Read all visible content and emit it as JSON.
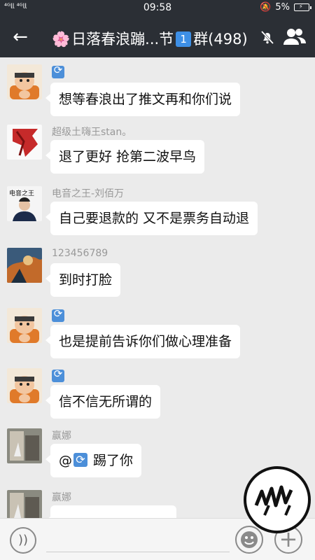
{
  "status_bar": {
    "signal_left": "⁴ᴳ𝗅𝗅 ⁴ᴳ𝗅𝗅",
    "time": "09:58",
    "battery_percent": "5%"
  },
  "header": {
    "title_prefix": "🌸",
    "title_text": "日落春浪蹦...节",
    "badge": "1",
    "title_suffix": "群(498)"
  },
  "messages": [
    {
      "sender": "",
      "text": "想等春浪出了推文再和你们说",
      "avatar": "avatar-cartoon",
      "has_badge": true
    },
    {
      "sender": "超级土嗨王stan。",
      "text": "退了更好  抢第二波早鸟",
      "avatar": "avatar-red",
      "has_badge": false
    },
    {
      "sender": "电音之王-刘佰万",
      "text": "自己要退款的 又不是票务自动退",
      "avatar": "avatar-person",
      "has_badge": false
    },
    {
      "sender": "123456789",
      "text": "到时打脸",
      "avatar": "avatar-painting",
      "has_badge": false
    },
    {
      "sender": "",
      "text": "也是提前告诉你们做心理准备",
      "avatar": "avatar-cartoon",
      "has_badge": true
    },
    {
      "sender": "",
      "text": "信不信无所谓的",
      "avatar": "avatar-cartoon",
      "has_badge": true
    },
    {
      "sender": "赢娜",
      "text_prefix": "@",
      "text": " 踢了你",
      "avatar": "avatar-photo",
      "has_badge": false
    },
    {
      "sender": "赢娜",
      "text": "",
      "avatar": "avatar-photo",
      "has_badge": false
    }
  ],
  "colors": {
    "header_bg": "#2b2f35",
    "chat_bg": "#ebebeb",
    "bubble_bg": "#ffffff",
    "badge_blue": "#4c8fd9"
  },
  "icons": {
    "back": "back-arrow-icon",
    "mute": "mute-bell-icon",
    "group": "group-members-icon",
    "voice": "voice-icon",
    "emoji": "emoji-icon",
    "plus": "plus-icon"
  }
}
